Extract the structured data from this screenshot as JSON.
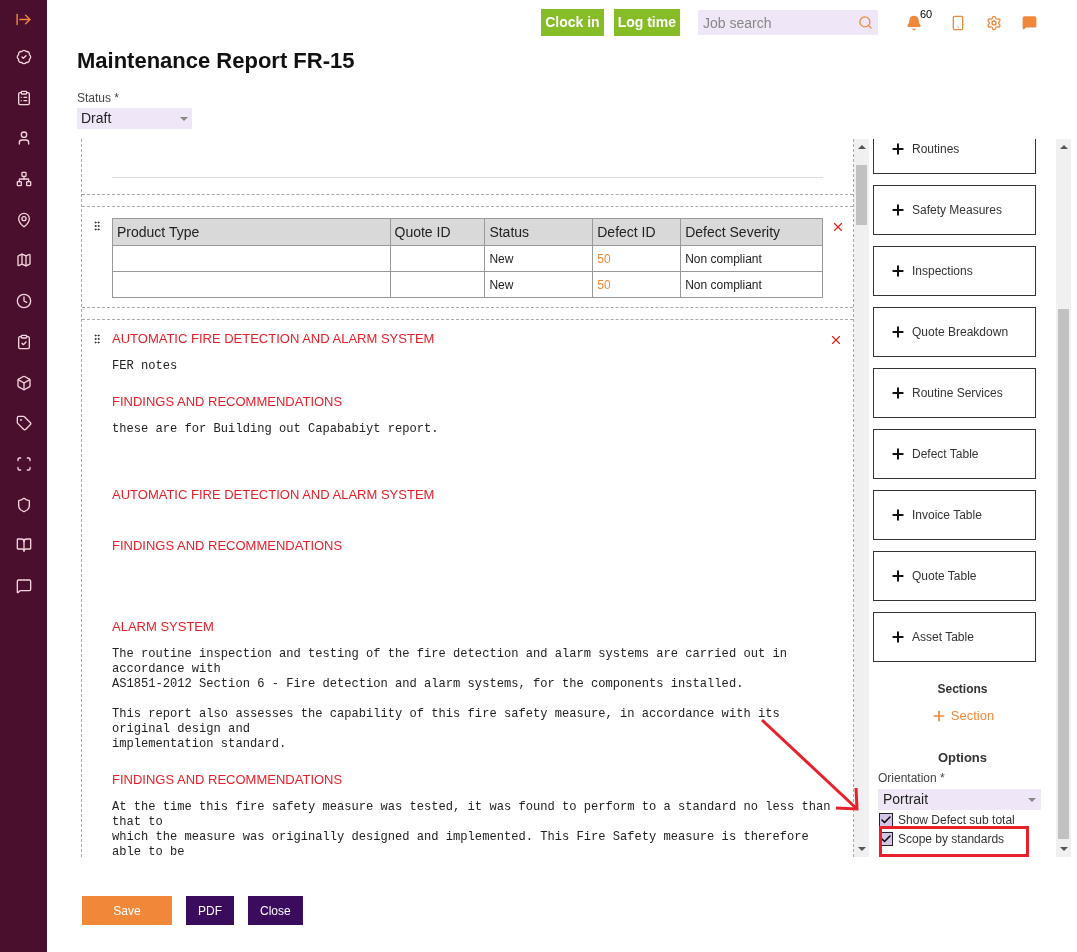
{
  "topbar": {
    "buttons": [
      "Clock in",
      "Log time"
    ],
    "search": {
      "placeholder": "Job search"
    },
    "notification_count": "60"
  },
  "title": "Maintenance Report FR-15",
  "status": {
    "label": "Status *",
    "value": "Draft"
  },
  "table": {
    "columns": [
      "Product Type",
      "Quote ID",
      "Status",
      "Defect ID",
      "Defect Severity"
    ],
    "rows": [
      [
        "",
        "",
        "New",
        "50",
        "Non compliant"
      ],
      [
        "",
        "",
        "New",
        "50",
        "Non compliant"
      ]
    ]
  },
  "content": [
    {
      "kind": "heading",
      "text": "AUTOMATIC FIRE DETECTION AND ALARM SYSTEM"
    },
    {
      "kind": "text",
      "text": "FER notes"
    },
    {
      "kind": "heading",
      "text": "FINDINGS AND RECOMMENDATIONS"
    },
    {
      "kind": "text",
      "text": "these are for Building out Capababiyt report."
    },
    {
      "kind": "blank"
    },
    {
      "kind": "blank"
    },
    {
      "kind": "heading",
      "text": "AUTOMATIC FIRE DETECTION AND ALARM SYSTEM"
    },
    {
      "kind": "blank"
    },
    {
      "kind": "heading",
      "text": "FINDINGS AND RECOMMENDATIONS"
    },
    {
      "kind": "blank"
    },
    {
      "kind": "blank"
    },
    {
      "kind": "blank"
    },
    {
      "kind": "heading",
      "text": "ALARM SYSTEM"
    },
    {
      "kind": "text",
      "text": "The routine inspection and testing of the fire detection and alarm systems are carried out in\naccordance with\nAS1851-2012 Section 6 - Fire detection and alarm systems, for the components installed.\n\nThis report also assesses the capability of this fire safety measure, in accordance with its\noriginal design and\nimplementation standard."
    },
    {
      "kind": "heading",
      "text": "FINDINGS AND RECOMMENDATIONS"
    },
    {
      "kind": "text",
      "text": "At the time this fire safety measure was tested, it was found to perform to a standard no less than\nthat to\nwhich the measure was originally designed and implemented. This Fire Safety measure is therefore\nable to be"
    }
  ],
  "blocks": [
    "Routines",
    "Safety Measures",
    "Inspections",
    "Quote Breakdown",
    "Routine Services",
    "Defect Table",
    "Invoice Table",
    "Quote Table",
    "Asset Table"
  ],
  "sections": {
    "title": "Sections",
    "add": "Section"
  },
  "options": {
    "title": "Options",
    "orientation_label": "Orientation *",
    "orientation": "Portrait",
    "checkboxes": [
      {
        "label": "Show Defect sub total",
        "checked": true
      },
      {
        "label": "Scope by standards",
        "checked": true
      }
    ]
  },
  "footer": {
    "buttons": [
      {
        "label": "Save",
        "kind": "primary"
      },
      {
        "label": "PDF",
        "kind": "secondary"
      },
      {
        "label": "Close",
        "kind": "secondary"
      }
    ]
  }
}
